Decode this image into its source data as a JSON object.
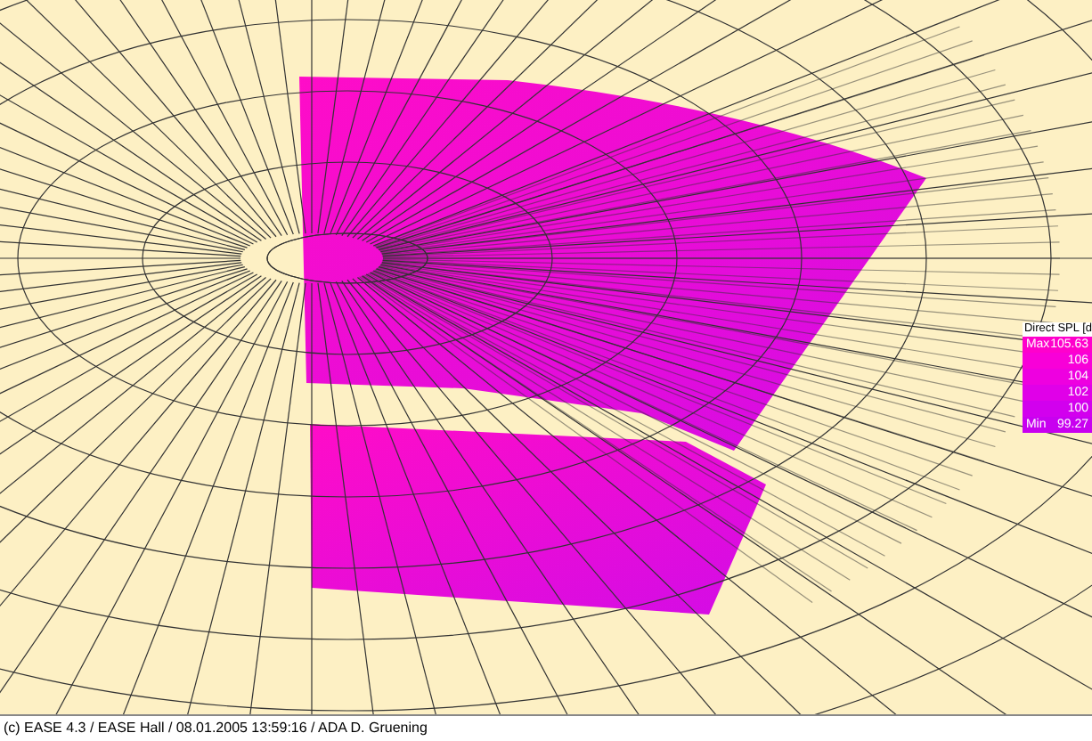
{
  "legend": {
    "title": "Direct SPL [d",
    "rows": [
      {
        "label": "Max",
        "value": "105.63",
        "color": "#ff00cc"
      },
      {
        "label": "",
        "value": "106",
        "color": "#f800d8"
      },
      {
        "label": "",
        "value": "104",
        "color": "#ee00e0"
      },
      {
        "label": "",
        "value": "102",
        "color": "#e000e8"
      },
      {
        "label": "",
        "value": "100",
        "color": "#d200ee"
      },
      {
        "label": "Min",
        "value": "99.27",
        "color": "#c800f0"
      }
    ]
  },
  "status_bar": "(c) EASE 4.3 / EASE Hall / 08.01.2005 13:59:16 / ADA D. Gruening"
}
